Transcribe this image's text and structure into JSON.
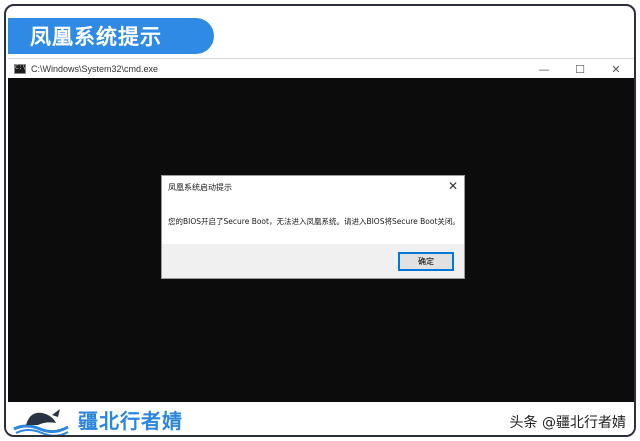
{
  "banner": {
    "title": "凤凰系统提示"
  },
  "cmd_window": {
    "title": "C:\\Windows\\System32\\cmd.exe",
    "icon": "cmd-icon",
    "controls": {
      "minimize": "—",
      "maximize": "☐",
      "close": "✕"
    }
  },
  "dialog": {
    "title": "凤凰系统启动提示",
    "message": "您的BIOS开启了Secure Boot，无法进入凤凰系统。请进入BIOS将Secure Boot关闭。",
    "close_glyph": "✕",
    "ok_label": "确定"
  },
  "footer": {
    "brand": "疆北行者婧",
    "watermark": "头条 @疆北行者婧"
  },
  "colors": {
    "banner": "#2f8ae6",
    "brand": "#2b86e0",
    "console_bg": "#0c0c0c",
    "dialog_footer": "#f0f0f0",
    "ok_border": "#0078d7"
  }
}
